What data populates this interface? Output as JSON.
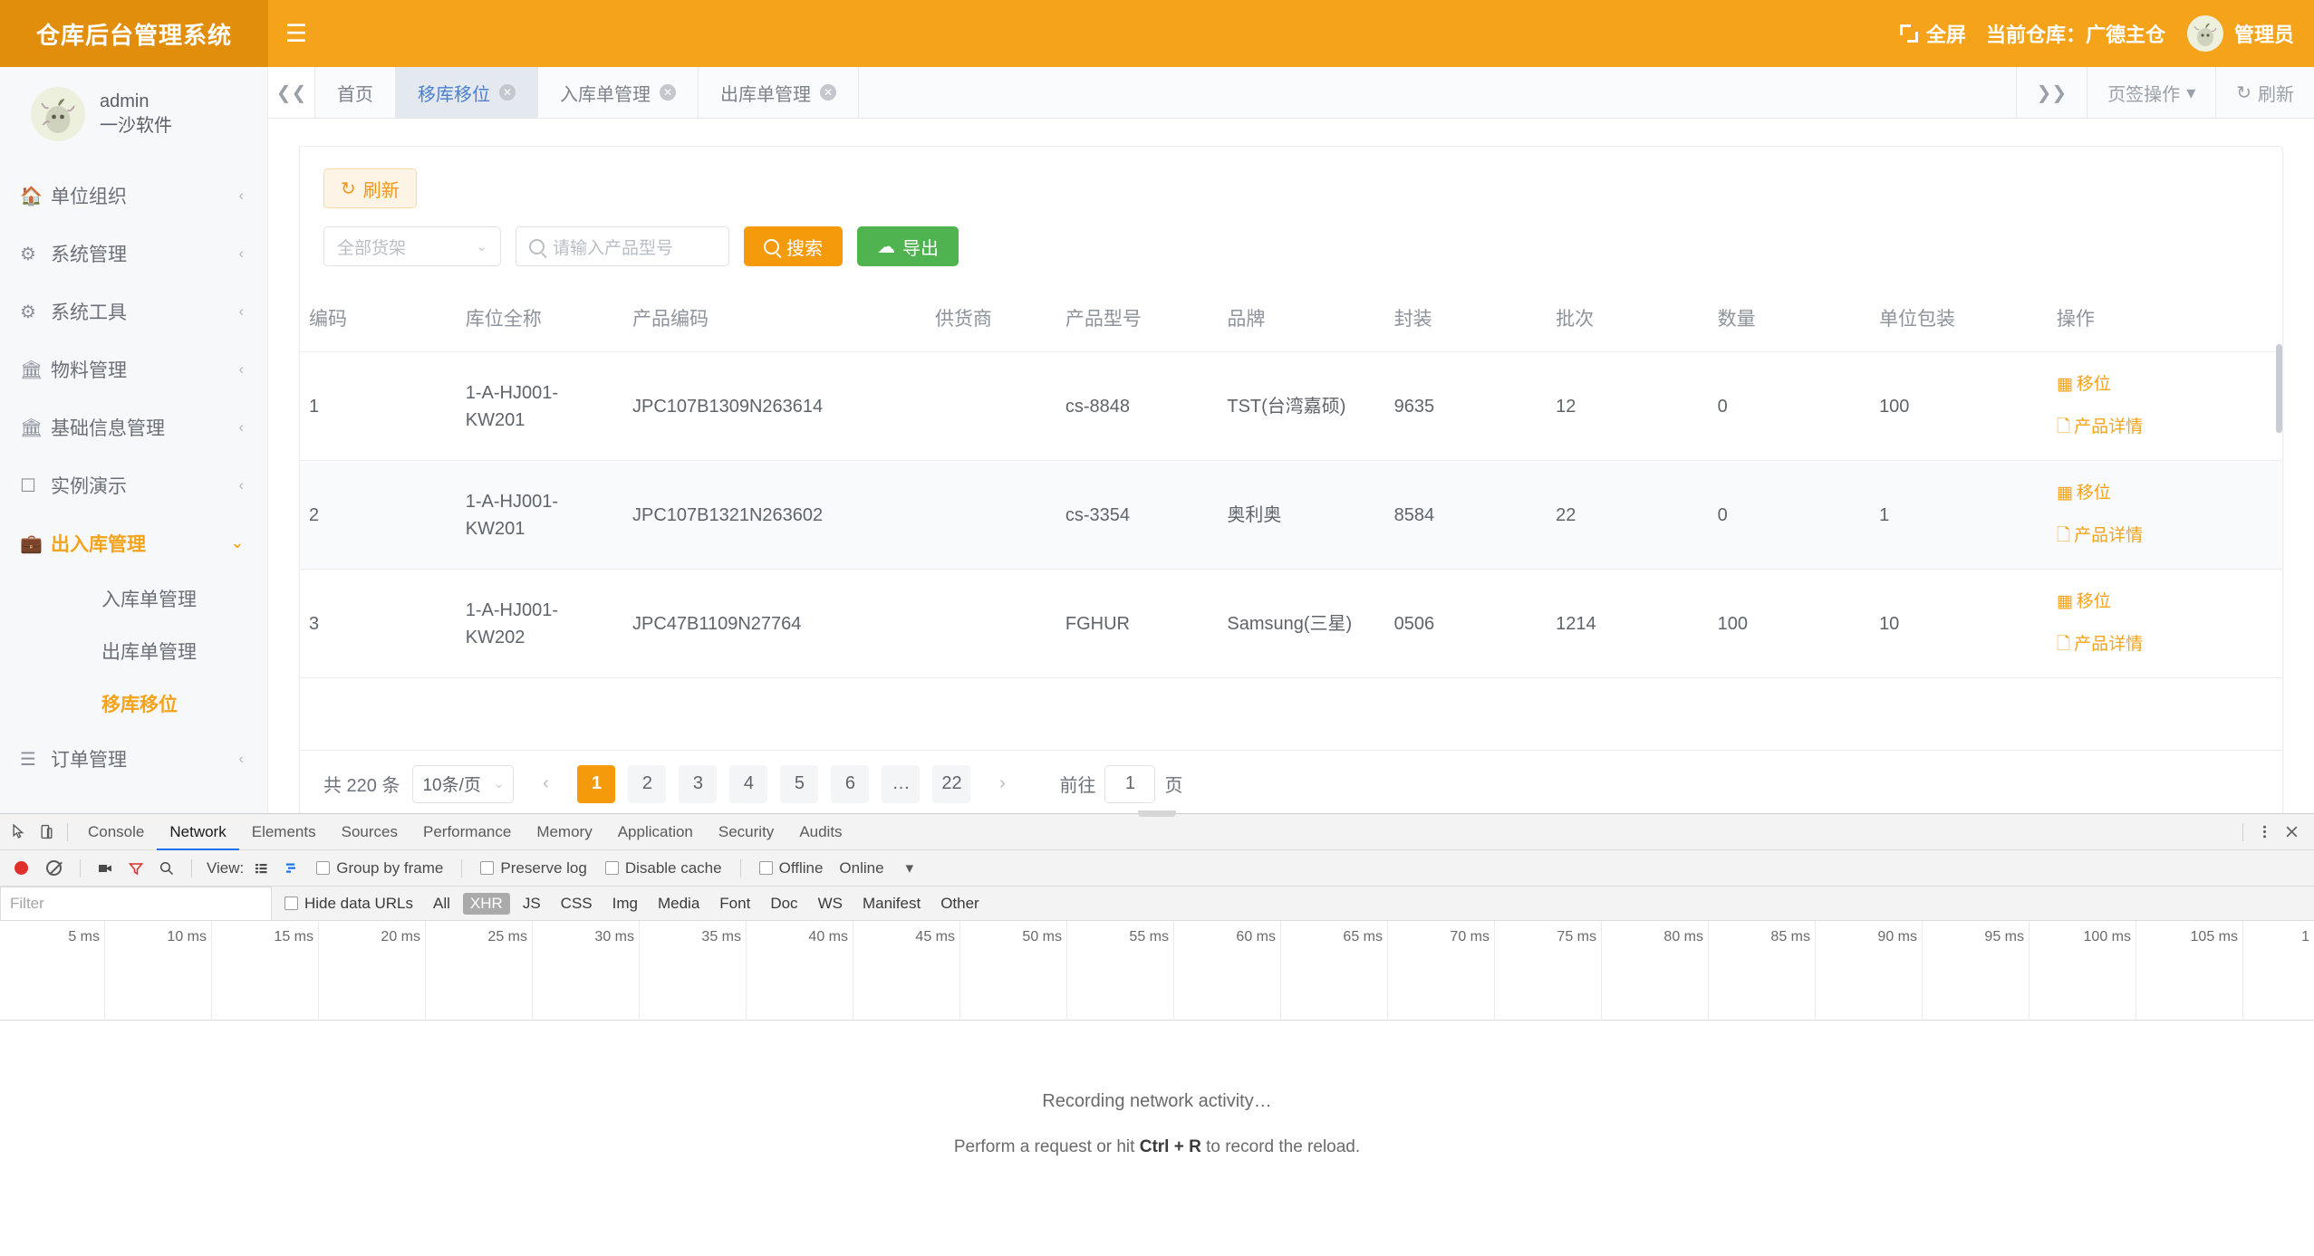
{
  "header": {
    "brand": "仓库后台管理系统",
    "menu_toggle_icon": "hamburger-icon",
    "fullscreen_label": "全屏",
    "current_warehouse_label": "当前仓库：广德主仓",
    "admin_label": "管理员",
    "accent": "#f5a31a",
    "brand_bg": "#e28e0d"
  },
  "sidebar": {
    "profile": {
      "username": "admin",
      "company": "一沙软件"
    },
    "items": [
      {
        "label": "单位组织",
        "icon": "home-icon",
        "arrow": "‹",
        "active": false
      },
      {
        "label": "系统管理",
        "icon": "gear-icon",
        "arrow": "‹",
        "active": false
      },
      {
        "label": "系统工具",
        "icon": "gears-icon",
        "arrow": "‹",
        "active": false
      },
      {
        "label": "物料管理",
        "icon": "bank-icon",
        "arrow": "‹",
        "active": false
      },
      {
        "label": "基础信息管理",
        "icon": "bank-icon",
        "arrow": "‹",
        "active": false
      },
      {
        "label": "实例演示",
        "icon": "square-icon",
        "arrow": "‹",
        "active": false
      },
      {
        "label": "出入库管理",
        "icon": "briefcase-icon",
        "arrow": "⌄",
        "active": true
      },
      {
        "label": "订单管理",
        "icon": "list-icon",
        "arrow": "‹",
        "active": false
      }
    ],
    "sub_items": [
      {
        "label": "入库单管理",
        "active": false
      },
      {
        "label": "出库单管理",
        "active": false
      },
      {
        "label": "移库移位",
        "active": true
      }
    ]
  },
  "tabbar": {
    "collapse_left_icon": "chevrons-left-icon",
    "collapse_right_icon": "chevrons-right-icon",
    "tabs": [
      {
        "label": "首页",
        "closable": false,
        "selected": false
      },
      {
        "label": "移库移位",
        "closable": true,
        "selected": true
      },
      {
        "label": "入库单管理",
        "closable": true,
        "selected": false
      },
      {
        "label": "出库单管理",
        "closable": true,
        "selected": false
      }
    ],
    "tab_ops_label": "页签操作",
    "tab_ops_caret": "▾",
    "refresh_label": "刷新",
    "refresh_icon": "refresh-icon"
  },
  "toolbar": {
    "refresh_label": "刷新",
    "refresh_icon": "refresh-icon",
    "shelf_select_value": "全部货架",
    "shelf_select_caret": "⌄",
    "search_placeholder": "请输入产品型号",
    "search_icon": "search-icon",
    "search_button_label": "搜索",
    "export_button_label": "导出",
    "export_icon": "cloud-upload-icon"
  },
  "table": {
    "columns": [
      "编码",
      "库位全称",
      "产品编码",
      "供货商",
      "产品型号",
      "品牌",
      "封装",
      "批次",
      "数量",
      "单位包装",
      "操作"
    ],
    "rows": [
      {
        "code": "1",
        "location": "1-A-HJ001-KW201",
        "product_code": "JPC107B1309N263614",
        "supplier": "",
        "model": "cs-8848",
        "brand": "TST(台湾嘉硕)",
        "package": "9635",
        "batch": "12",
        "qty": "0",
        "unit_pack": "100",
        "ops": [
          "移位",
          "产品详情"
        ]
      },
      {
        "code": "2",
        "location": "1-A-HJ001-KW201",
        "product_code": "JPC107B1321N263602",
        "supplier": "",
        "model": "cs-3354",
        "brand": "奥利奥",
        "package": "8584",
        "batch": "22",
        "qty": "0",
        "unit_pack": "1",
        "ops": [
          "移位",
          "产品详情"
        ]
      },
      {
        "code": "3",
        "location": "1-A-HJ001-KW202",
        "product_code": "JPC47B1109N27764",
        "supplier": "",
        "model": "FGHUR",
        "brand": "Samsung(三星)",
        "package": "0506",
        "batch": "1214",
        "qty": "100",
        "unit_pack": "10",
        "ops": [
          "移位",
          "产品详情"
        ]
      }
    ],
    "op_move_icon": "grid-icon",
    "op_detail_icon": "document-icon"
  },
  "pagination": {
    "total_label": "共 220 条",
    "page_size": "10条/页",
    "page_size_caret": "⌄",
    "prev_icon": "‹",
    "next_icon": "›",
    "pages": [
      "1",
      "2",
      "3",
      "4",
      "5",
      "6",
      "…",
      "22"
    ],
    "current_page": "1",
    "jump_prefix": "前往",
    "jump_value": "1",
    "jump_suffix": "页"
  },
  "devtools": {
    "inspect_icon": "inspect-cursor-icon",
    "device_icon": "device-toolbar-icon",
    "tabs": [
      "Console",
      "Network",
      "Elements",
      "Sources",
      "Performance",
      "Memory",
      "Application",
      "Security",
      "Audits"
    ],
    "selected_tab": "Network",
    "more_icon": "kebab-menu-icon",
    "close_icon": "close-icon",
    "record_icon": "record-dot-icon",
    "clear_icon": "clear-icon",
    "camera_icon": "camera-icon",
    "filter_icon": "funnel-icon",
    "search_icon": "search-icon",
    "view_label": "View:",
    "view_list_icon": "list-view-icon",
    "view_waterfall_icon": "waterfall-view-icon",
    "group_by_frame": "Group by frame",
    "preserve_log": "Preserve log",
    "disable_cache": "Disable cache",
    "offline": "Offline",
    "online": "Online",
    "throttle_caret": "▾",
    "filter_placeholder": "Filter",
    "hide_data_urls": "Hide data URLs",
    "types": [
      "All",
      "XHR",
      "JS",
      "CSS",
      "Img",
      "Media",
      "Font",
      "Doc",
      "WS",
      "Manifest",
      "Other"
    ],
    "selected_type": "XHR",
    "timeline_ticks": [
      "5 ms",
      "10 ms",
      "15 ms",
      "20 ms",
      "25 ms",
      "30 ms",
      "35 ms",
      "40 ms",
      "45 ms",
      "50 ms",
      "55 ms",
      "60 ms",
      "65 ms",
      "70 ms",
      "75 ms",
      "80 ms",
      "85 ms",
      "90 ms",
      "95 ms",
      "100 ms",
      "105 ms",
      "1"
    ],
    "empty_line1": "Recording network activity…",
    "empty_line2_prefix": "Perform a request or hit ",
    "empty_line2_key": "Ctrl + R",
    "empty_line2_suffix": " to record the reload."
  }
}
